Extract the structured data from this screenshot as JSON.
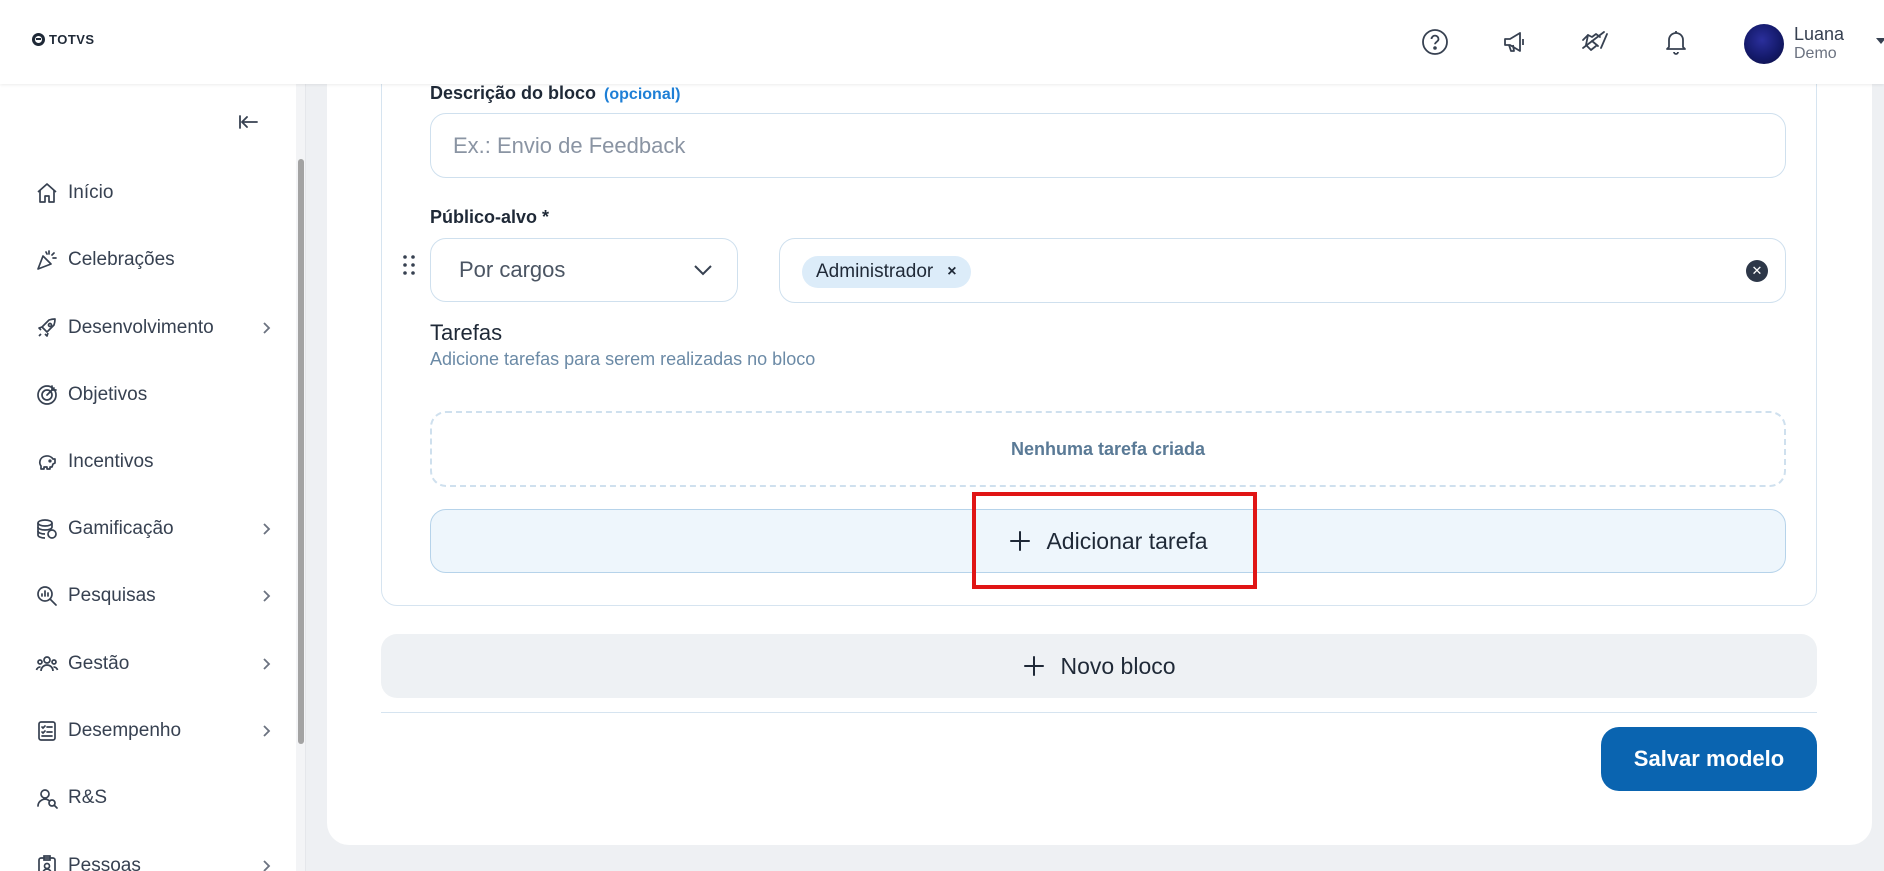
{
  "app": {
    "logo_text": "TOTVS"
  },
  "header": {
    "icons": [
      "help-icon",
      "megaphone-icon",
      "handshake-icon",
      "bell-icon"
    ],
    "user": {
      "name": "Luana",
      "role": "Demo"
    }
  },
  "sidebar": {
    "items": [
      {
        "label": "Início",
        "icon": "home-icon",
        "has_children": false
      },
      {
        "label": "Celebrações",
        "icon": "party-icon",
        "has_children": false
      },
      {
        "label": "Desenvolvimento",
        "icon": "rocket-icon",
        "has_children": true
      },
      {
        "label": "Objetivos",
        "icon": "target-icon",
        "has_children": false
      },
      {
        "label": "Incentivos",
        "icon": "piggy-bank-icon",
        "has_children": false
      },
      {
        "label": "Gamificação",
        "icon": "coins-icon",
        "has_children": true
      },
      {
        "label": "Pesquisas",
        "icon": "search-chart-icon",
        "has_children": true
      },
      {
        "label": "Gestão",
        "icon": "team-icon",
        "has_children": true
      },
      {
        "label": "Desempenho",
        "icon": "checklist-icon",
        "has_children": true
      },
      {
        "label": "R&S",
        "icon": "user-search-icon",
        "has_children": false
      },
      {
        "label": "Pessoas",
        "icon": "id-badge-icon",
        "has_children": true
      }
    ]
  },
  "form": {
    "description": {
      "label": "Descrição do bloco",
      "optional": "(opcional)",
      "placeholder": "Ex.: Envio de Feedback",
      "value": ""
    },
    "audience": {
      "label": "Público-alvo *",
      "type_value": "Por cargos",
      "chips": [
        "Administrador"
      ]
    },
    "tasks": {
      "title": "Tarefas",
      "subtitle": "Adicione tarefas para serem realizadas no bloco",
      "empty_text": "Nenhuma tarefa criada",
      "add_label": "Adicionar tarefa"
    },
    "new_block_label": "Novo bloco",
    "save_label": "Salvar modelo"
  },
  "colors": {
    "primary": "#0a64b0",
    "highlight": "#e01515",
    "optional": "#1e7fd6"
  }
}
